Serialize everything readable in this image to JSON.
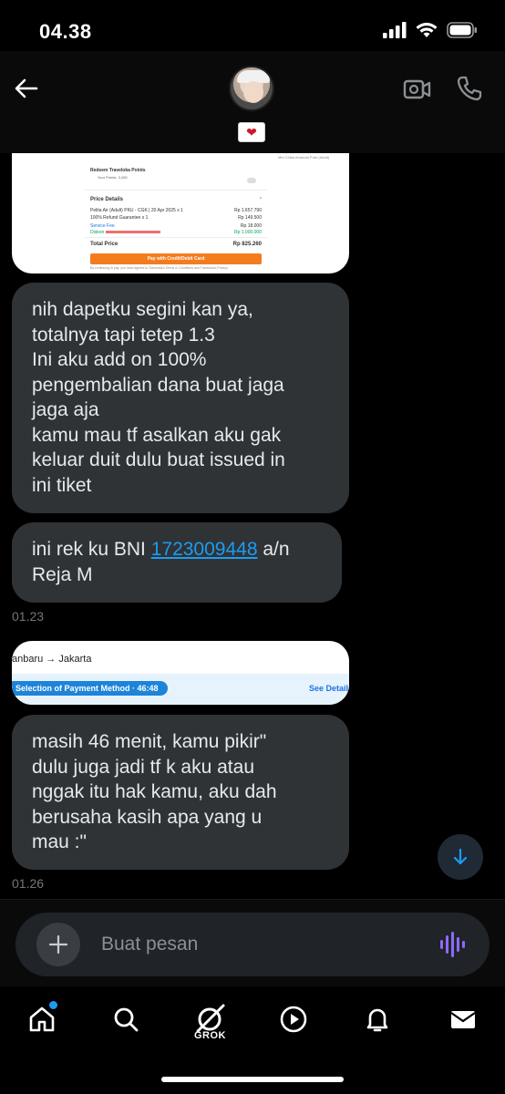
{
  "status_bar": {
    "time": "04.38"
  },
  "header": {
    "heart_badge": "❤"
  },
  "messages": [
    {
      "type": "image",
      "content": {
        "redeem_label": "Redeem Traveloka Points",
        "your_points": "Your Points: 3,265",
        "side_note": "Mrs Chika Amanda Putri (Adult)",
        "price_details_title": "Price Details",
        "rows": [
          {
            "label": "Pelita Air (Adult) PKU - CGK | 20 Apr 2025 x 1",
            "value": "Rp 1.657.790"
          },
          {
            "label": "100% Refund Guarantee x 1",
            "value": "Rp 149.500"
          },
          {
            "label": "Service Fee",
            "value": "Rp 18.000"
          },
          {
            "label": "Diskon",
            "value": "Rp 1.000.000"
          }
        ],
        "total_label": "Total Price",
        "total_value": "Rp 825.260",
        "pay_button": "Pay with Credit/Debit Card",
        "footnote": "By continuing to pay, you have agreed to Traveloka's Terms & Conditions and Traveloka's Privacy"
      }
    },
    {
      "type": "text",
      "lines": [
        "nih dapetku segini kan ya,",
        "totalnya tapi tetep 1.3",
        "Ini aku add on 100%",
        "pengembalian dana buat jaga",
        "jaga aja",
        "kamu mau tf asalkan aku gak",
        "keluar duit dulu buat issued in",
        "ini tiket"
      ]
    },
    {
      "type": "text",
      "prefix": "ini rek ku BNI ",
      "account_number": "1723009448",
      "suffix": " a/n",
      "line2": "Reja M"
    },
    {
      "type": "timestamp",
      "text": "01.23"
    },
    {
      "type": "image",
      "content": {
        "route": "anbaru → Jakarta",
        "pill": "Selection of Payment Method · 46:48",
        "see_detail": "See Detail"
      }
    },
    {
      "type": "text",
      "lines": [
        "masih 46 menit, kamu pikir\"",
        "dulu juga jadi tf k aku atau",
        "nggak itu hak kamu, aku dah",
        "berusaha kasih apa yang u",
        "mau :\""
      ]
    },
    {
      "type": "timestamp",
      "text": "01.26"
    }
  ],
  "composer": {
    "placeholder": "Buat pesan"
  },
  "tab_bar": {
    "grok_label": "GROK",
    "tabs": [
      "home-icon",
      "search-icon",
      "grok-icon",
      "video-icon",
      "notifications-icon",
      "messages-icon"
    ]
  },
  "colors": {
    "background": "#000000",
    "bubble": "#2f3336",
    "link": "#1d9bf0",
    "accent_voice": "#8b6cf6",
    "timestamp": "#71767b"
  }
}
